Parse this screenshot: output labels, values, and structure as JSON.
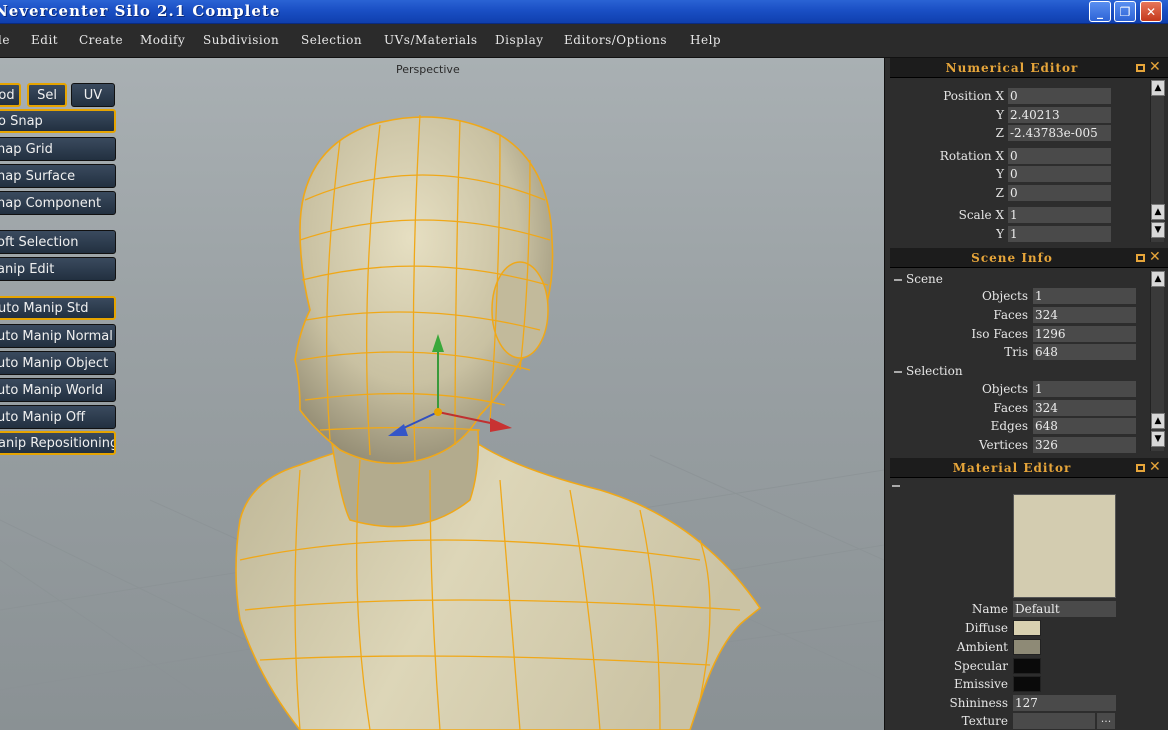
{
  "window": {
    "title": "Nevercenter Silo 2.1 Complete",
    "min_glyph": "_",
    "max_glyph": "❐",
    "close_glyph": "✕"
  },
  "menu": [
    "le",
    "Edit",
    "Create",
    "Modify",
    "Subdivision",
    "Selection",
    "UVs/Materials",
    "Display",
    "Editors/Options",
    "Help"
  ],
  "viewport": {
    "label": "Perspective"
  },
  "toolbar": {
    "mode_buttons": [
      "od",
      "Sel",
      "UV"
    ],
    "buttons": [
      "o Snap",
      "nap Grid",
      "nap Surface",
      "nap Component",
      "oft Selection",
      "anip Edit",
      "uto Manip Std",
      "uto Manip Normal",
      "uto Manip Object",
      "uto Manip World",
      "uto Manip Off",
      "anip Repositioning"
    ]
  },
  "numerical_editor": {
    "title": "Numerical Editor",
    "rows": [
      {
        "label": "Position X",
        "value": "0"
      },
      {
        "label": "Y",
        "value": "2.40213"
      },
      {
        "label": "Z",
        "value": "-2.43783e-005"
      },
      {
        "label": "Rotation X",
        "value": "0"
      },
      {
        "label": "Y",
        "value": "0"
      },
      {
        "label": "Z",
        "value": "0"
      },
      {
        "label": "Scale X",
        "value": "1"
      },
      {
        "label": "Y",
        "value": "1"
      }
    ]
  },
  "scene_info": {
    "title": "Scene Info",
    "scene_label": "Scene",
    "scene_rows": [
      {
        "label": "Objects",
        "value": "1"
      },
      {
        "label": "Faces",
        "value": "324"
      },
      {
        "label": "Iso Faces",
        "value": "1296"
      },
      {
        "label": "Tris",
        "value": "648"
      }
    ],
    "selection_label": "Selection",
    "selection_rows": [
      {
        "label": "Objects",
        "value": "1"
      },
      {
        "label": "Faces",
        "value": "324"
      },
      {
        "label": "Edges",
        "value": "648"
      },
      {
        "label": "Vertices",
        "value": "326"
      }
    ]
  },
  "material_editor": {
    "title": "Material Editor",
    "preview_color": "#d3ccb0",
    "name_label": "Name",
    "name_value": "Default",
    "diffuse_label": "Diffuse",
    "diffuse_color": "#d8d0b0",
    "ambient_label": "Ambient",
    "ambient_color": "#8e8a76",
    "specular_label": "Specular",
    "specular_color": "#0a0a0a",
    "emissive_label": "Emissive",
    "emissive_color": "#0a0a0a",
    "shininess_label": "Shininess",
    "shininess_value": "127",
    "texture_label": "Texture",
    "texture_button": "..."
  },
  "colors": {
    "accent": "#e6a53a",
    "wire": "#f0a818",
    "mesh": "#d6cfb0"
  },
  "icons": [
    "minimize-icon",
    "maximize-icon",
    "close-icon",
    "panel-float-icon",
    "panel-close-icon",
    "scroll-up-icon",
    "scroll-down-icon"
  ]
}
